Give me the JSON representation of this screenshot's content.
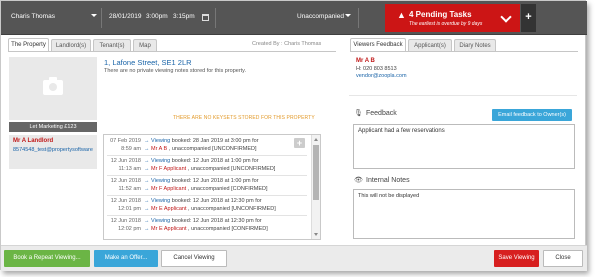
{
  "topbar": {
    "agent": "Charis Thomas",
    "date": "28/01/2019",
    "start_time": "3:00pm",
    "end_time": "3:15pm",
    "accompany": "Unaccompanied",
    "pending_title": "4 Pending Tasks",
    "pending_sub": "The earliest is overdue by 9 days",
    "plus": "+"
  },
  "left_tabs": [
    "The Property",
    "Landlord(s)",
    "Tenant(s)",
    "Map"
  ],
  "right_tabs": [
    "Viewers Feedback",
    "Applicant(s)",
    "Diary Notes"
  ],
  "property": {
    "created_by": "Created By : Charis Thomas",
    "address": "1, Lafone Street, SE1 2LR",
    "note": "There are no private viewing notes stored for this property.",
    "marketing_badge": "Let Marketing £123",
    "no_keysets": "THERE ARE NO KEYSETS STORED FOR THIS PROPERTY",
    "landlord_name": "Mr A Landlord",
    "landlord_contact": "8574548_test@propertysoftware"
  },
  "timeline": [
    {
      "date": "07 Feb 2019",
      "time": "8:59 am",
      "link": "Viewing",
      "line1": " booked: 28 Jan 2019 at 3:00 pm for",
      "person": "Mr A B",
      "line2": " , unaccompanied [UNCONFIRMED]"
    },
    {
      "date": "12 Jun 2018",
      "time": "11:13 am",
      "link": "Viewing",
      "line1": " booked: 12 Jun 2018 at 1:00 pm for",
      "person": "Mr F Applicant",
      "line2": " , unaccompanied [UNCONFIRMED]"
    },
    {
      "date": "12 Jun 2018",
      "time": "11:52 am",
      "link": "Viewing",
      "line1": " booked: 12 Jun 2018 at 1:00 pm for",
      "person": "Mr F Applicant",
      "line2": " , unaccompanied [CONFIRMED]"
    },
    {
      "date": "12 Jun 2018",
      "time": "12:01 pm",
      "link": "Viewing",
      "line1": " booked: 12 Jun 2018 at 12:30 pm for",
      "person": "Mr E Applicant",
      "line2": " , unaccompanied [UNCONFIRMED]"
    },
    {
      "date": "12 Jun 2018",
      "time": "12:02 pm",
      "link": "Viewing",
      "line1": " booked: 12 Jun 2018 at 12:30 pm for",
      "person": "Mr E Applicant",
      "line2": " , unaccompanied [CONFIRMED]"
    }
  ],
  "vendor": {
    "name": "Mr A B",
    "phone": "H: 020 803 8513",
    "email": "vendor@zoopla.com"
  },
  "feedback": {
    "label": "Feedback",
    "button": "Email feedback to Owner(s)",
    "text": "Applicant had a few reservations"
  },
  "notes": {
    "label": "Internal Notes",
    "text": "This will not be displayed"
  },
  "footer": {
    "repeat": "Book a Repeat Viewing...",
    "offer": "Make an Offer...",
    "cancel": "Cancel Viewing",
    "save": "Save Viewing",
    "close": "Close"
  },
  "colors": {
    "topbar": "#555555",
    "alert": "#cc1515",
    "link": "#1a64a8",
    "accent_blue": "#3aa6d9",
    "green": "#6bb545",
    "warning_orange": "#e39b2c"
  },
  "icons": [
    "calendar-icon",
    "warning-icon",
    "chevron-down-icon",
    "camera-icon",
    "microphone-icon",
    "eye-icon",
    "add-icon"
  ]
}
